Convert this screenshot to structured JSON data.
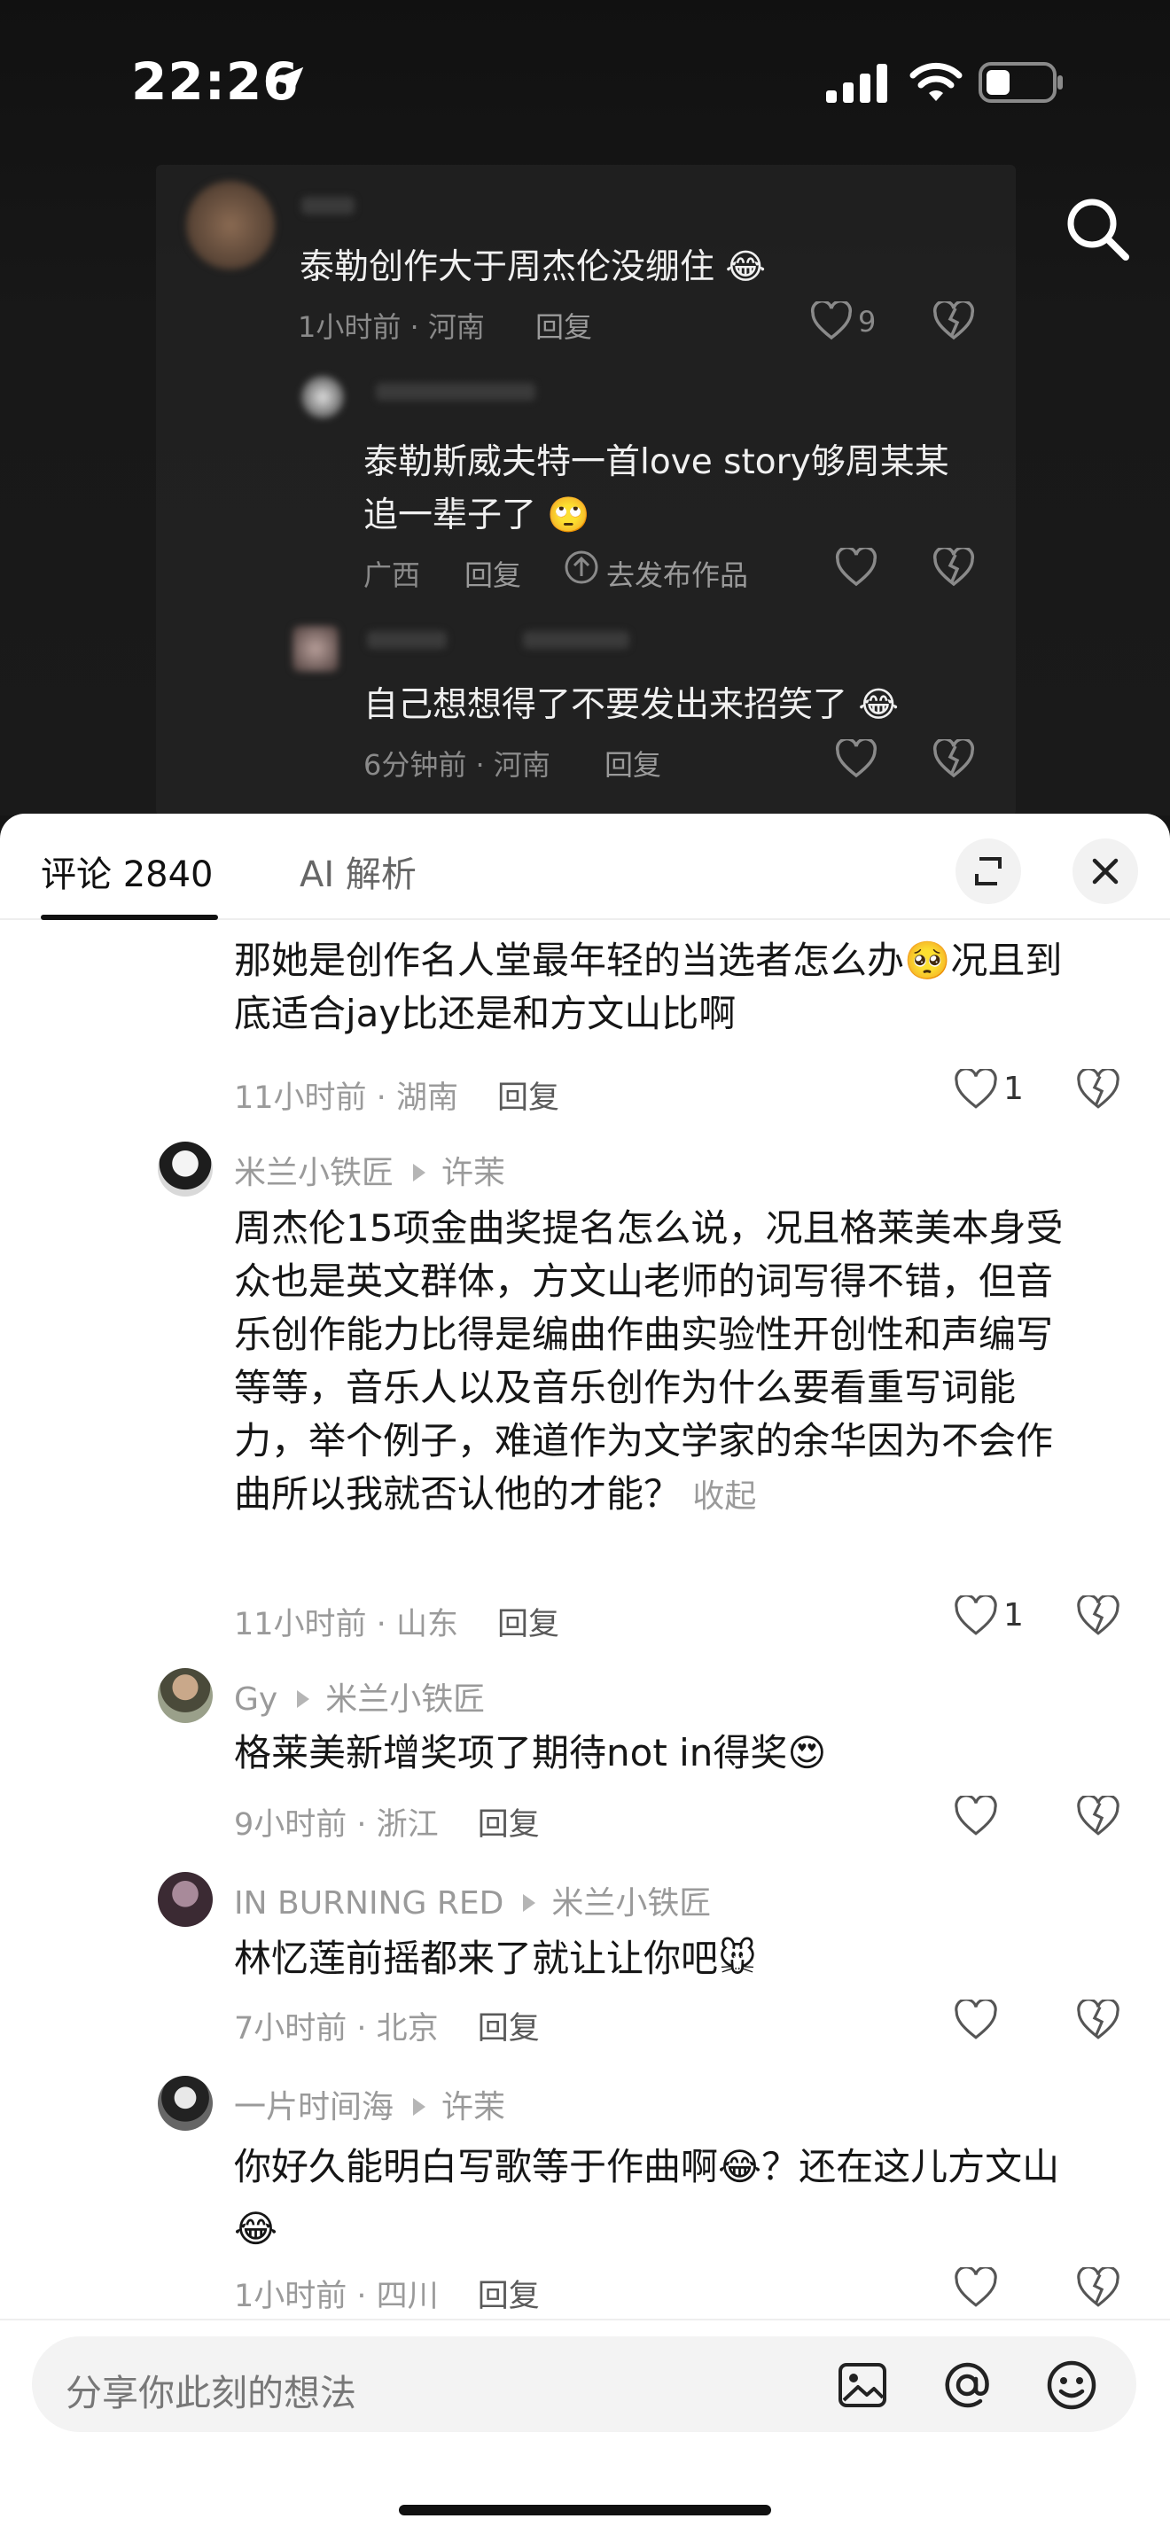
{
  "status_bar": {
    "time": "22:26"
  },
  "background_thread": {
    "comment": {
      "text": "泰勒创作大于周杰伦没绷住",
      "time": "1小时前",
      "region": "河南",
      "reply_label": "回复",
      "likes": "9"
    },
    "replies": [
      {
        "line1": "泰勒斯威夫特一首love story够周某某",
        "line2": "追一辈子了",
        "region": "广西",
        "reply_label": "回复",
        "publish_label": "去发布作品"
      },
      {
        "text": "自己想想得了不要发出来招笑了",
        "time": "6分钟前",
        "region": "河南",
        "reply_label": "回复"
      }
    ]
  },
  "sheet": {
    "tab_comments": "评论 2840",
    "tab_ai": "AI 解析"
  },
  "comments": [
    {
      "text1": "那她是创作名人堂最年轻的当选者怎么办",
      "text2": "况且到",
      "text3": "底适合jay比还是和方文山比啊",
      "time": "11小时前",
      "region": "湖南",
      "reply_label": "回复",
      "likes": "1"
    },
    {
      "user": "米兰小铁匠",
      "reply_to": "许茉",
      "lines": [
        "周杰伦15项金曲奖提名怎么说，况且格莱美本身受",
        "众也是英文群体，方文山老师的词写得不错，但音",
        "乐创作能力比得是编曲作曲实验性开创性和声编写",
        "等等，音乐人以及音乐创作为什么要看重写词能",
        "力，举个例子，难道作为文学家的余华因为不会作",
        "曲所以我就否认他的才能？"
      ],
      "collapse_label": "收起",
      "time": "11小时前",
      "region": "山东",
      "reply_label": "回复",
      "likes": "1"
    },
    {
      "user": "Gy",
      "reply_to": "米兰小铁匠",
      "text": "格莱美新增奖项了期待not  in得奖",
      "time": "9小时前",
      "region": "浙江",
      "reply_label": "回复"
    },
    {
      "user": "IN BURNING RED",
      "reply_to": "米兰小铁匠",
      "text": "林忆莲前摇都来了就让让你吧",
      "time": "7小时前",
      "region": "北京",
      "reply_label": "回复"
    },
    {
      "user": "一片时间海",
      "reply_to": "许茉",
      "text1": "你好久能明白写歌等于作曲啊",
      "text2": "？还在这儿方文山",
      "time": "1小时前",
      "region": "四川",
      "reply_label": "回复"
    }
  ],
  "input": {
    "placeholder": "分享你此刻的想法"
  },
  "icons": {
    "location": "location-arrow-icon",
    "search": "search-icon",
    "expand": "expand-icon",
    "close": "close-icon",
    "image": "image-icon",
    "mention": "at-mention-icon",
    "emoji": "emoji-icon"
  }
}
